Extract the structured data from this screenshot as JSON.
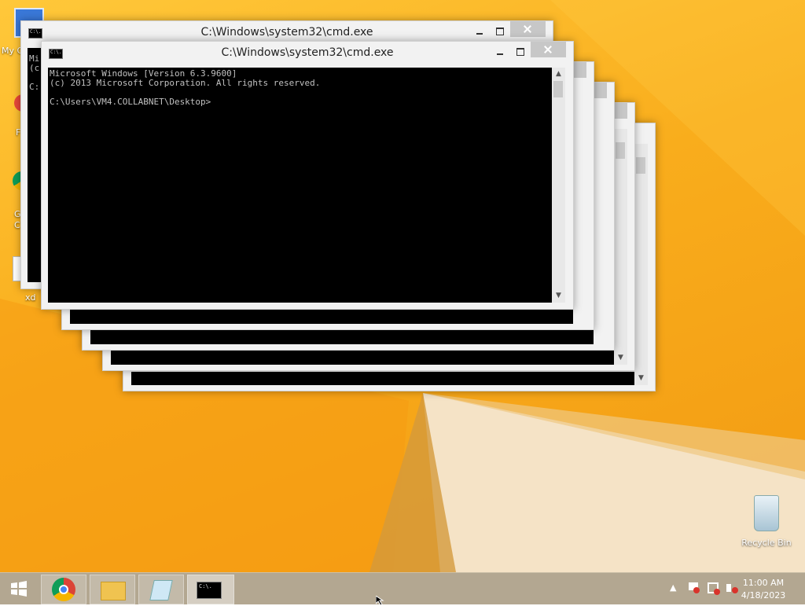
{
  "desktop": {
    "icons": {
      "mycomputer_label": "My C",
      "xd_label": "xd",
      "recycle_bin_label": "Recycle Bin",
      "partial_f": "F",
      "partial_g": "G",
      "partial_c": "C"
    }
  },
  "windows": {
    "front": {
      "title": "C:\\Windows\\system32\\cmd.exe",
      "console_lines": [
        "Microsoft Windows [Version 6.3.9600]",
        "(c) 2013 Microsoft Corporation. All rights reserved.",
        "",
        "C:\\Users\\VM4.COLLABNET\\Desktop>"
      ]
    },
    "back": {
      "title": "C:\\Windows\\system32\\cmd.exe",
      "console_peek_1": "(c",
      "console_peek_2": "C:",
      "title_peek": "Mi"
    },
    "icon_text": "C:\\."
  },
  "taskbar": {
    "apps": [
      "start-button",
      "chrome",
      "file-explorer",
      "notepad",
      "command-prompt"
    ],
    "clock": {
      "time": "11:00 AM",
      "date": "4/18/2023"
    }
  },
  "colors": {
    "wallpaper": "#f9ad1c",
    "taskbar": "#b3a791",
    "console_bg": "#000000",
    "console_text": "#c0c0c0"
  }
}
